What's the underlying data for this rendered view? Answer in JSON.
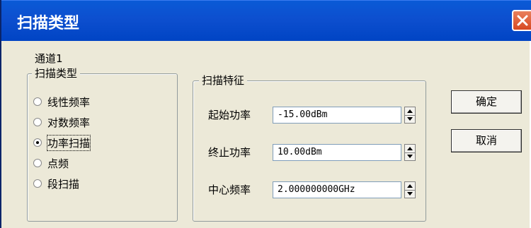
{
  "window": {
    "title": "扫描类型"
  },
  "channel_label": "通道1",
  "scan_type_group": {
    "legend": "扫描类型",
    "options": [
      {
        "label": "线性频率",
        "selected": false
      },
      {
        "label": "对数频率",
        "selected": false
      },
      {
        "label": "功率扫描",
        "selected": true
      },
      {
        "label": "点频",
        "selected": false
      },
      {
        "label": "段扫描",
        "selected": false
      }
    ]
  },
  "scan_feature_group": {
    "legend": "扫描特征",
    "fields": [
      {
        "label": "起始功率",
        "value": "-15.00dBm"
      },
      {
        "label": "终止功率",
        "value": "10.00dBm"
      },
      {
        "label": "中心频率",
        "value": "2.000000000GHz"
      }
    ]
  },
  "buttons": {
    "ok": "确定",
    "cancel": "取消"
  },
  "icons": {
    "close": "close-icon",
    "spin_up": "spin-up-icon",
    "spin_down": "spin-down-icon"
  },
  "colors": {
    "titlebar": "#0a5ad6",
    "dialog_bg": "#ece9d8",
    "close_button": "#d74821"
  }
}
